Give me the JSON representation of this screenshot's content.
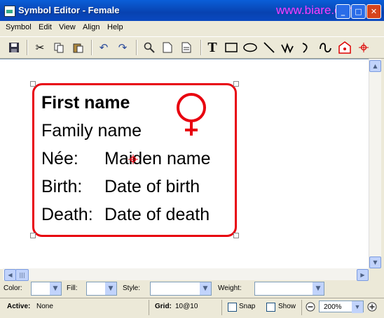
{
  "window": {
    "title": "Symbol Editor - Female",
    "watermark": "www.biare.com"
  },
  "menu": [
    "Symbol",
    "Edit",
    "View",
    "Align",
    "Help"
  ],
  "toolbar_icons": [
    "save-icon",
    "cut-icon",
    "copy-icon",
    "paste-icon",
    "undo-icon",
    "redo-icon",
    "zoom-icon",
    "page-icon",
    "page-lines-icon",
    "text-tool-icon",
    "rectangle-tool-icon",
    "ellipse-tool-icon",
    "line-tool-icon",
    "polyline-tool-icon",
    "arc-tool-icon",
    "curve-tool-icon",
    "anchor-tool-icon",
    "center-tool-icon"
  ],
  "symbol": {
    "line1": "First name",
    "line2": "Family name",
    "nee_label": "Née:",
    "nee_value": "Maiden name",
    "birth_label": "Birth:",
    "birth_value": "Date of birth",
    "death_label": "Death:",
    "death_value": "Date of death",
    "accent_color": "#e8000f"
  },
  "properties": {
    "color_label": "Color:",
    "fill_label": "Fill:",
    "style_label": "Style:",
    "weight_label": "Weight:"
  },
  "status": {
    "active_label": "Active:",
    "active_value": "None",
    "grid_label": "Grid:",
    "grid_value": "10@10",
    "snap_label": "Snap",
    "show_label": "Show",
    "zoom_value": "200%"
  }
}
